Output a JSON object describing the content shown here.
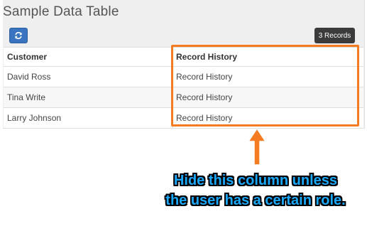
{
  "page": {
    "title": "Sample Data Table"
  },
  "toolbar": {
    "records_label": "3 Records"
  },
  "table": {
    "headers": [
      "Customer",
      "Record History"
    ],
    "rows": [
      [
        "David Ross",
        "Record History"
      ],
      [
        "Tina Write",
        "Record History"
      ],
      [
        "Larry Johnson",
        "Record History"
      ]
    ]
  },
  "annotation": {
    "line1": "Hide this column unless",
    "line2": "the user has a certain role.",
    "highlight_color": "#f47b20",
    "text_color": "#1aa9ff"
  },
  "icons": {
    "refresh": "refresh-icon",
    "arrow": "arrow-up-icon"
  }
}
